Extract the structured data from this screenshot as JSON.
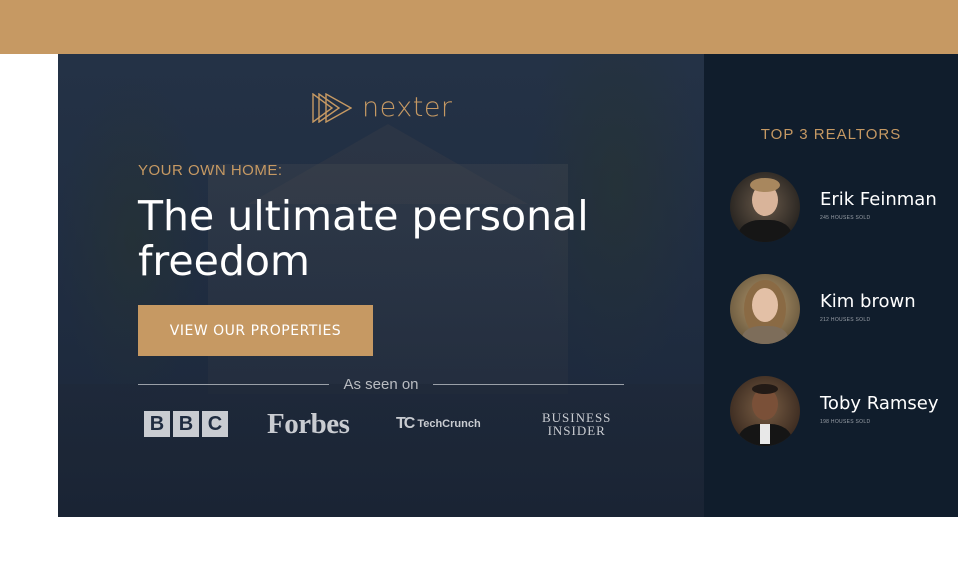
{
  "brand": {
    "name": "nexter",
    "accent": "#c69963",
    "dark": "#101d2c"
  },
  "hero": {
    "eyebrow": "YOUR OWN HOME:",
    "headline": "The ultimate personal freedom",
    "cta_label": "VIEW OUR PROPERTIES",
    "seen_on_label": "As seen on",
    "press": {
      "bbc": [
        "B",
        "B",
        "C"
      ],
      "forbes": "Forbes",
      "techcrunch_mark": "TC",
      "techcrunch": "TechCrunch",
      "business_insider_line1": "BUSINESS",
      "business_insider_line2": "INSIDER"
    }
  },
  "sidebar": {
    "title": "TOP 3 REALTORS",
    "realtors": [
      {
        "name": "Erik Feinman",
        "sold": "245 HOUSES SOLD"
      },
      {
        "name": "Kim brown",
        "sold": "212 HOUSES SOLD"
      },
      {
        "name": "Toby Ramsey",
        "sold": "198 HOUSES SOLD"
      }
    ]
  }
}
